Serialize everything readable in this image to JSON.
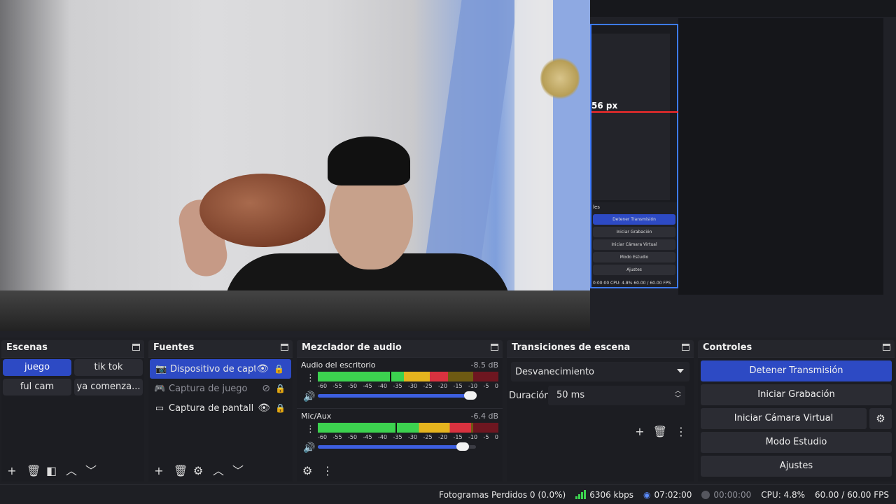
{
  "nested_preview": {
    "px_label": "56 px",
    "header": "les",
    "buttons": [
      "Detener Transmisión",
      "Iniciar Grabación",
      "Iniciar Cámara Virtual",
      "Modo Estudio",
      "Ajustes"
    ],
    "status": "0:00:00   CPU: 4.8%   60.00 / 60.00 FPS"
  },
  "scenes": {
    "title": "Escenas",
    "items": [
      "juego",
      "tik tok",
      "ful cam",
      "ya comenza..."
    ]
  },
  "sources": {
    "title": "Fuentes",
    "items": [
      {
        "name": "Dispositivo de captura",
        "icon": "camera-icon"
      },
      {
        "name": "Captura de juego",
        "icon": "gamepad-icon"
      },
      {
        "name": "Captura de pantalla",
        "icon": "monitor-icon"
      }
    ]
  },
  "mixer": {
    "title": "Mezclador de audio",
    "channels": [
      {
        "name": "Audio del escritorio",
        "db": "-8.5 dB",
        "level": 0.72,
        "volume": 0.98
      },
      {
        "name": "Mic/Aux",
        "db": "-6.4 dB",
        "level": 0.85,
        "volume": 0.93
      }
    ],
    "ticks": [
      "-60",
      "-55",
      "-50",
      "-45",
      "-40",
      "-35",
      "-30",
      "-25",
      "-20",
      "-15",
      "-10",
      "-5",
      "0"
    ]
  },
  "transitions": {
    "title": "Transiciones de escena",
    "selected": "Desvanecimiento",
    "duration_label": "Duración",
    "duration_value": "50 ms"
  },
  "controls": {
    "title": "Controles",
    "stop_stream": "Detener Transmisión",
    "start_recording": "Iniciar Grabación",
    "start_virtual_cam": "Iniciar Cámara Virtual",
    "studio_mode": "Modo Estudio",
    "settings": "Ajustes"
  },
  "status": {
    "dropped_frames": "Fotogramas Perdidos 0 (0.0%)",
    "bitrate": "6306 kbps",
    "stream_time": "07:02:00",
    "rec_time": "00:00:00",
    "cpu": "CPU: 4.8%",
    "fps": "60.00 / 60.00 FPS"
  },
  "colors": {
    "accent": "#2d4ac4",
    "meter_green": "#3cd24f",
    "meter_yellow": "#e5b41e",
    "meter_red": "#d9323f"
  }
}
